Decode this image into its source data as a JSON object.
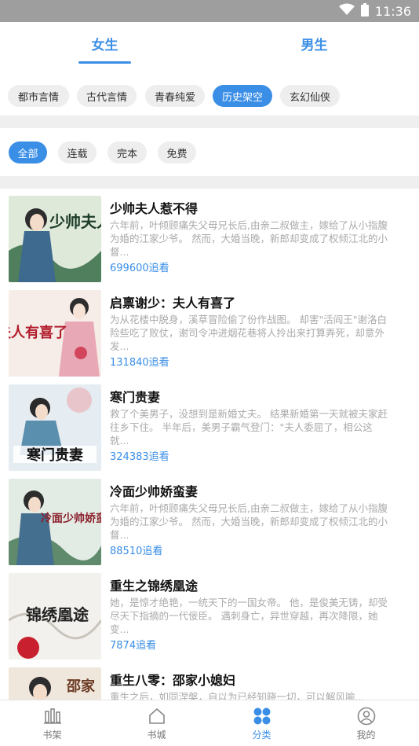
{
  "status_bar": {
    "time": "11:36",
    "wifi_icon": "wifi-icon",
    "battery_icon": "battery-icon"
  },
  "gender_tabs": [
    {
      "label": "女生",
      "active": true
    },
    {
      "label": "男生",
      "active": false
    }
  ],
  "categories": [
    {
      "label": "都市言情",
      "active": false
    },
    {
      "label": "古代言情",
      "active": false
    },
    {
      "label": "青春纯爱",
      "active": false
    },
    {
      "label": "历史架空",
      "active": true
    },
    {
      "label": "玄幻仙侠",
      "active": false
    }
  ],
  "filters": [
    {
      "label": "全部",
      "active": true
    },
    {
      "label": "连载",
      "active": false
    },
    {
      "label": "完本",
      "active": false
    },
    {
      "label": "免费",
      "active": false
    }
  ],
  "books": [
    {
      "title": "少帅夫人惹不得",
      "desc": "六年前，叶倾顾痛失父母兄长后,由亲二叔做主，嫁给了从小指腹为婚的江家少爷。 然而，大婚当晚，新郎却变成了权倾江北的小督...",
      "count": "699600追看"
    },
    {
      "title": "启禀谢少：夫人有喜了",
      "desc": "为从花楼中脱身，溪草冒险偷了份作战图。 却害\"活阎王\"谢洛白险些吃了败仗，谢司令冲进烟花巷将人拎出来打算弄死，却意外发...",
      "count": "131840追看"
    },
    {
      "title": "寒门贵妻",
      "desc": "救了个美男子，没想到是新婚丈夫。 结果新婚第一天就被夫家赶往乡下住。 半年后，美男子霸气登门：\"夫人委屈了，相公这就...",
      "count": "324383追看"
    },
    {
      "title": "冷面少帅娇蛮妻",
      "desc": "六年前，叶倾顾痛失父母兄长后,由亲二叔做主，嫁给了从小指腹为婚的江家少爷。 然而，大婚当晚，新郎却变成了权倾江北的小督...",
      "count": "88510追看"
    },
    {
      "title": "重生之锦绣凰途",
      "desc": "她，是惊才绝艳，一统天下的一国女帝。 他，是俊美无铸，却受尽天下指摘的一代佞臣。 遇刺身亡，异世穿越，再次降限，她变...",
      "count": "7874追看"
    },
    {
      "title": "重生八零：邵家小媳妇",
      "desc": "重生之后，如同涅槃，自以为已经知晓一切，可以解风喻...",
      "count": ""
    }
  ],
  "cover_text": [
    "少帅夫人",
    "夫人有喜了",
    "寒门贵妻",
    "冷面少帅娇蛮妻",
    "锦绣凰途",
    "邵家"
  ],
  "bottom_nav": [
    {
      "label": "书架",
      "icon": "bookshelf-icon",
      "active": false
    },
    {
      "label": "书城",
      "icon": "home-icon",
      "active": false
    },
    {
      "label": "分类",
      "icon": "category-icon",
      "active": true
    },
    {
      "label": "我的",
      "icon": "profile-icon",
      "active": false
    }
  ],
  "colors": {
    "accent": "#3a8ee6",
    "chip_bg": "#eeeeee",
    "divider": "#efefef",
    "status_bar": "#9e9e9e"
  }
}
